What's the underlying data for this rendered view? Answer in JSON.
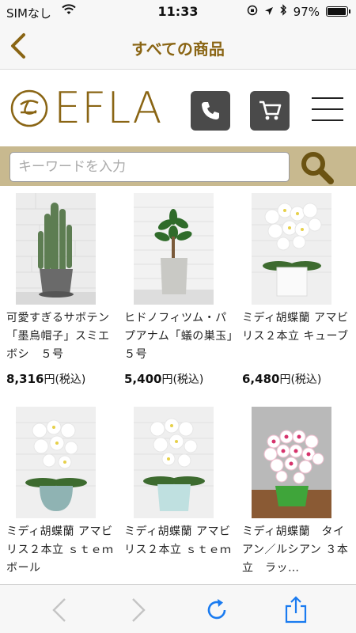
{
  "status_bar": {
    "carrier": "SIMなし",
    "time": "11:33",
    "battery": "97%"
  },
  "nav": {
    "title": "すべての商品"
  },
  "brand": {
    "logo_text": "EFLA",
    "colors": {
      "gold": "#8a6514",
      "searchbar": "#c8b98f",
      "icon_bg": "#4a4a4a",
      "reload_blue": "#1a7bf0"
    }
  },
  "search": {
    "placeholder": "キーワードを入力"
  },
  "products": [
    {
      "name": "可愛すぎるサボテン「墨烏帽子」スミエボシ　５号",
      "price": "8,316",
      "price_suffix": "円(税込)"
    },
    {
      "name": "ヒドノフィツム・パプアナム「蟻の巣玉」　５号",
      "price": "5,400",
      "price_suffix": "円(税込)"
    },
    {
      "name": "ミディ胡蝶蘭 アマビリス２本立 キューブ",
      "price": "6,480",
      "price_suffix": "円(税込)"
    },
    {
      "name": "ミディ胡蝶蘭 アマビリス２本立 ｓｔｅｍボール",
      "price": "",
      "price_suffix": ""
    },
    {
      "name": "ミディ胡蝶蘭 アマビリス２本立 ｓｔｅｍ",
      "price": "",
      "price_suffix": ""
    },
    {
      "name": "ミディ胡蝶蘭　タイアン／ルシアン ３本立　ラッ…",
      "price": "",
      "price_suffix": ""
    }
  ],
  "toolbar": {
    "icons": [
      "back-arrow-icon",
      "forward-arrow-icon",
      "reload-icon",
      "share-icon"
    ]
  }
}
